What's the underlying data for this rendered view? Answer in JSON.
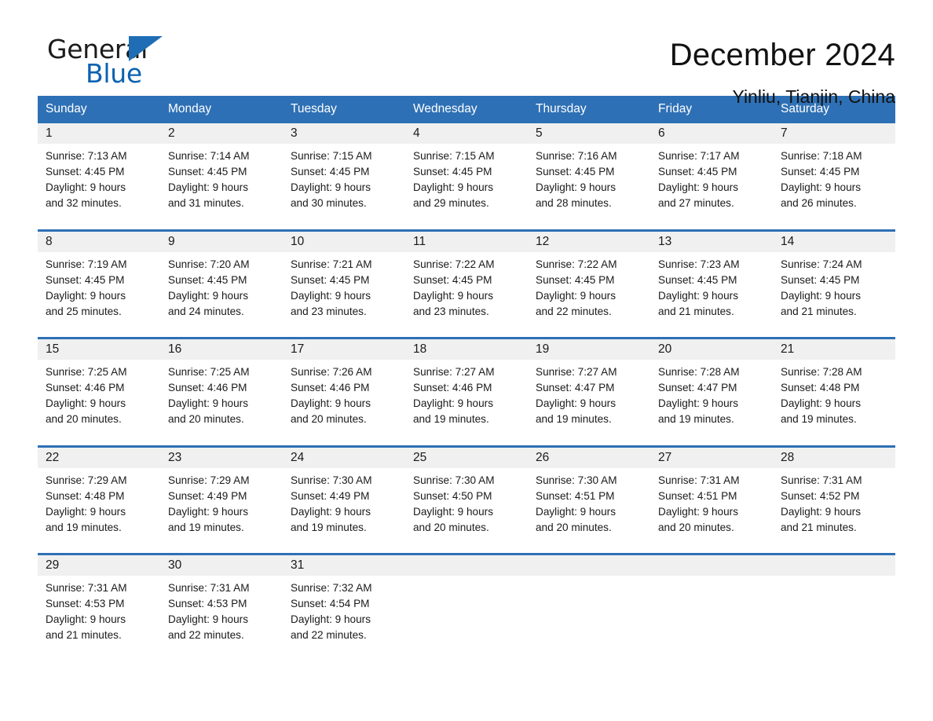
{
  "brand": {
    "name_part1": "General",
    "name_part2": "Blue",
    "triangle_color": "#1f6eb5",
    "blue_text_color": "#0b63b0"
  },
  "header": {
    "month_title": "December 2024",
    "location": "Yinliu, Tianjin, China"
  },
  "theme": {
    "header_blue": "#2E70B5",
    "daynum_band": "#f0f0f0",
    "text": "#1a1a1a"
  },
  "weekdays": [
    "Sunday",
    "Monday",
    "Tuesday",
    "Wednesday",
    "Thursday",
    "Friday",
    "Saturday"
  ],
  "weeks": [
    [
      {
        "day": "1",
        "sunrise": "Sunrise: 7:13 AM",
        "sunset": "Sunset: 4:45 PM",
        "daylight1": "Daylight: 9 hours",
        "daylight2": "and 32 minutes."
      },
      {
        "day": "2",
        "sunrise": "Sunrise: 7:14 AM",
        "sunset": "Sunset: 4:45 PM",
        "daylight1": "Daylight: 9 hours",
        "daylight2": "and 31 minutes."
      },
      {
        "day": "3",
        "sunrise": "Sunrise: 7:15 AM",
        "sunset": "Sunset: 4:45 PM",
        "daylight1": "Daylight: 9 hours",
        "daylight2": "and 30 minutes."
      },
      {
        "day": "4",
        "sunrise": "Sunrise: 7:15 AM",
        "sunset": "Sunset: 4:45 PM",
        "daylight1": "Daylight: 9 hours",
        "daylight2": "and 29 minutes."
      },
      {
        "day": "5",
        "sunrise": "Sunrise: 7:16 AM",
        "sunset": "Sunset: 4:45 PM",
        "daylight1": "Daylight: 9 hours",
        "daylight2": "and 28 minutes."
      },
      {
        "day": "6",
        "sunrise": "Sunrise: 7:17 AM",
        "sunset": "Sunset: 4:45 PM",
        "daylight1": "Daylight: 9 hours",
        "daylight2": "and 27 minutes."
      },
      {
        "day": "7",
        "sunrise": "Sunrise: 7:18 AM",
        "sunset": "Sunset: 4:45 PM",
        "daylight1": "Daylight: 9 hours",
        "daylight2": "and 26 minutes."
      }
    ],
    [
      {
        "day": "8",
        "sunrise": "Sunrise: 7:19 AM",
        "sunset": "Sunset: 4:45 PM",
        "daylight1": "Daylight: 9 hours",
        "daylight2": "and 25 minutes."
      },
      {
        "day": "9",
        "sunrise": "Sunrise: 7:20 AM",
        "sunset": "Sunset: 4:45 PM",
        "daylight1": "Daylight: 9 hours",
        "daylight2": "and 24 minutes."
      },
      {
        "day": "10",
        "sunrise": "Sunrise: 7:21 AM",
        "sunset": "Sunset: 4:45 PM",
        "daylight1": "Daylight: 9 hours",
        "daylight2": "and 23 minutes."
      },
      {
        "day": "11",
        "sunrise": "Sunrise: 7:22 AM",
        "sunset": "Sunset: 4:45 PM",
        "daylight1": "Daylight: 9 hours",
        "daylight2": "and 23 minutes."
      },
      {
        "day": "12",
        "sunrise": "Sunrise: 7:22 AM",
        "sunset": "Sunset: 4:45 PM",
        "daylight1": "Daylight: 9 hours",
        "daylight2": "and 22 minutes."
      },
      {
        "day": "13",
        "sunrise": "Sunrise: 7:23 AM",
        "sunset": "Sunset: 4:45 PM",
        "daylight1": "Daylight: 9 hours",
        "daylight2": "and 21 minutes."
      },
      {
        "day": "14",
        "sunrise": "Sunrise: 7:24 AM",
        "sunset": "Sunset: 4:45 PM",
        "daylight1": "Daylight: 9 hours",
        "daylight2": "and 21 minutes."
      }
    ],
    [
      {
        "day": "15",
        "sunrise": "Sunrise: 7:25 AM",
        "sunset": "Sunset: 4:46 PM",
        "daylight1": "Daylight: 9 hours",
        "daylight2": "and 20 minutes."
      },
      {
        "day": "16",
        "sunrise": "Sunrise: 7:25 AM",
        "sunset": "Sunset: 4:46 PM",
        "daylight1": "Daylight: 9 hours",
        "daylight2": "and 20 minutes."
      },
      {
        "day": "17",
        "sunrise": "Sunrise: 7:26 AM",
        "sunset": "Sunset: 4:46 PM",
        "daylight1": "Daylight: 9 hours",
        "daylight2": "and 20 minutes."
      },
      {
        "day": "18",
        "sunrise": "Sunrise: 7:27 AM",
        "sunset": "Sunset: 4:46 PM",
        "daylight1": "Daylight: 9 hours",
        "daylight2": "and 19 minutes."
      },
      {
        "day": "19",
        "sunrise": "Sunrise: 7:27 AM",
        "sunset": "Sunset: 4:47 PM",
        "daylight1": "Daylight: 9 hours",
        "daylight2": "and 19 minutes."
      },
      {
        "day": "20",
        "sunrise": "Sunrise: 7:28 AM",
        "sunset": "Sunset: 4:47 PM",
        "daylight1": "Daylight: 9 hours",
        "daylight2": "and 19 minutes."
      },
      {
        "day": "21",
        "sunrise": "Sunrise: 7:28 AM",
        "sunset": "Sunset: 4:48 PM",
        "daylight1": "Daylight: 9 hours",
        "daylight2": "and 19 minutes."
      }
    ],
    [
      {
        "day": "22",
        "sunrise": "Sunrise: 7:29 AM",
        "sunset": "Sunset: 4:48 PM",
        "daylight1": "Daylight: 9 hours",
        "daylight2": "and 19 minutes."
      },
      {
        "day": "23",
        "sunrise": "Sunrise: 7:29 AM",
        "sunset": "Sunset: 4:49 PM",
        "daylight1": "Daylight: 9 hours",
        "daylight2": "and 19 minutes."
      },
      {
        "day": "24",
        "sunrise": "Sunrise: 7:30 AM",
        "sunset": "Sunset: 4:49 PM",
        "daylight1": "Daylight: 9 hours",
        "daylight2": "and 19 minutes."
      },
      {
        "day": "25",
        "sunrise": "Sunrise: 7:30 AM",
        "sunset": "Sunset: 4:50 PM",
        "daylight1": "Daylight: 9 hours",
        "daylight2": "and 20 minutes."
      },
      {
        "day": "26",
        "sunrise": "Sunrise: 7:30 AM",
        "sunset": "Sunset: 4:51 PM",
        "daylight1": "Daylight: 9 hours",
        "daylight2": "and 20 minutes."
      },
      {
        "day": "27",
        "sunrise": "Sunrise: 7:31 AM",
        "sunset": "Sunset: 4:51 PM",
        "daylight1": "Daylight: 9 hours",
        "daylight2": "and 20 minutes."
      },
      {
        "day": "28",
        "sunrise": "Sunrise: 7:31 AM",
        "sunset": "Sunset: 4:52 PM",
        "daylight1": "Daylight: 9 hours",
        "daylight2": "and 21 minutes."
      }
    ],
    [
      {
        "day": "29",
        "sunrise": "Sunrise: 7:31 AM",
        "sunset": "Sunset: 4:53 PM",
        "daylight1": "Daylight: 9 hours",
        "daylight2": "and 21 minutes."
      },
      {
        "day": "30",
        "sunrise": "Sunrise: 7:31 AM",
        "sunset": "Sunset: 4:53 PM",
        "daylight1": "Daylight: 9 hours",
        "daylight2": "and 22 minutes."
      },
      {
        "day": "31",
        "sunrise": "Sunrise: 7:32 AM",
        "sunset": "Sunset: 4:54 PM",
        "daylight1": "Daylight: 9 hours",
        "daylight2": "and 22 minutes."
      },
      {
        "day": "",
        "sunrise": "",
        "sunset": "",
        "daylight1": "",
        "daylight2": ""
      },
      {
        "day": "",
        "sunrise": "",
        "sunset": "",
        "daylight1": "",
        "daylight2": ""
      },
      {
        "day": "",
        "sunrise": "",
        "sunset": "",
        "daylight1": "",
        "daylight2": ""
      },
      {
        "day": "",
        "sunrise": "",
        "sunset": "",
        "daylight1": "",
        "daylight2": ""
      }
    ]
  ]
}
